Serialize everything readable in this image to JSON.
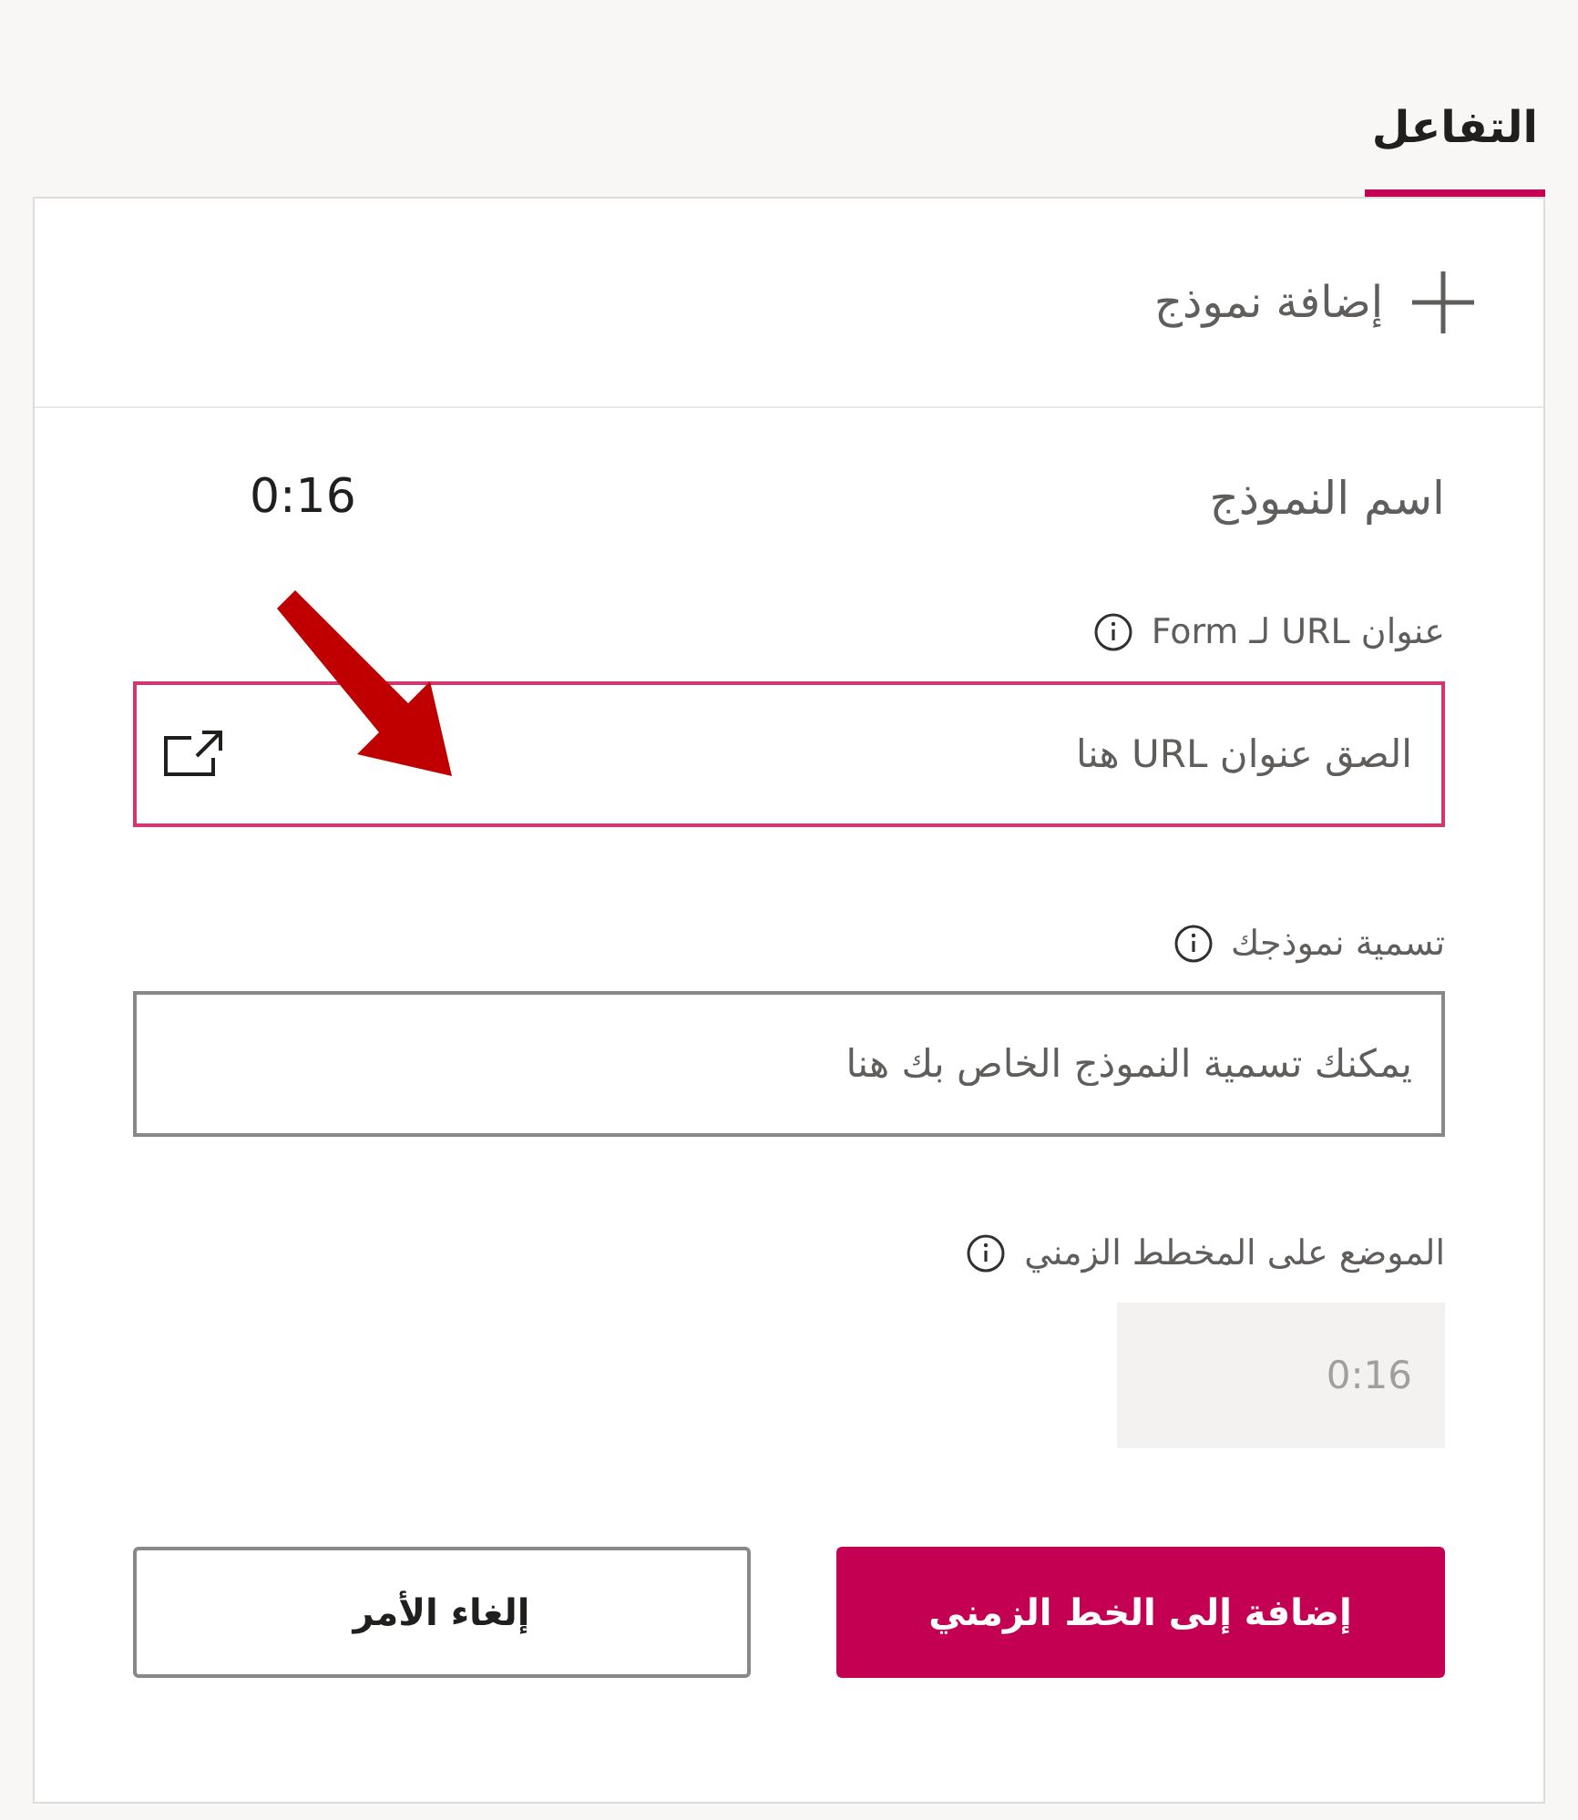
{
  "tabs": [
    {
      "label": "التفاعل",
      "selected": true
    }
  ],
  "add_form": {
    "label": "إضافة نموذج"
  },
  "form_title": "اسم النموذج",
  "time": "0:16",
  "fields": [
    {
      "kind": "url",
      "label": "عنوان URL لـ Form",
      "placeholder": "الصق عنوان URL هنا",
      "focused": true
    },
    {
      "kind": "text",
      "label": "تسمية نموذجك",
      "placeholder": "يمكنك تسمية النموذج الخاص بك هنا",
      "focused": false
    },
    {
      "kind": "time",
      "label": "الموضع على المخطط الزمني",
      "value": "0:16",
      "disabled": true
    }
  ],
  "buttons": [
    {
      "kind": "primary",
      "label": "إضافة إلى الخط الزمني"
    },
    {
      "kind": "secondary",
      "label": "إلغاء الأمر"
    }
  ]
}
